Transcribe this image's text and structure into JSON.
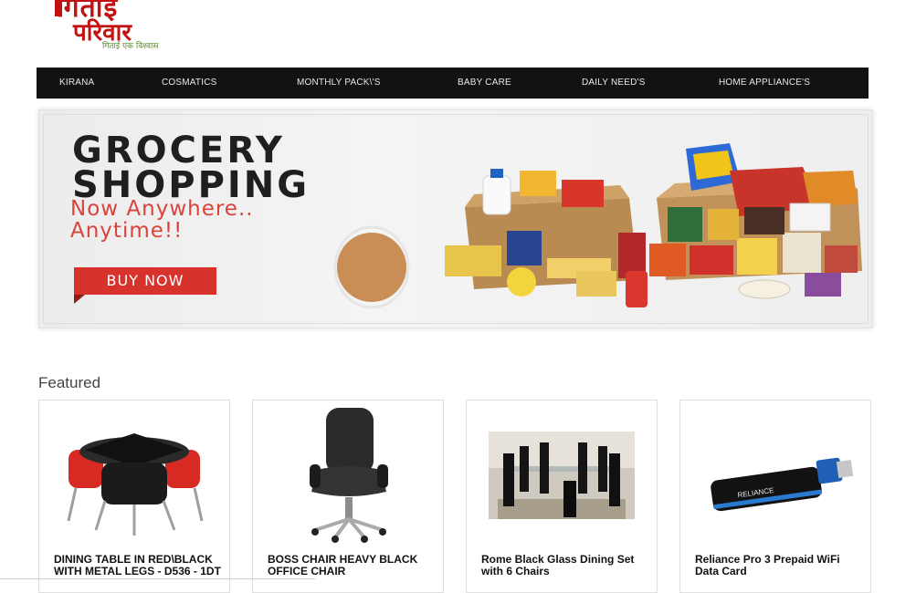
{
  "logo": {
    "line1": "गिताई",
    "line2": "परिवार",
    "tagline": "गिताई एक विश्वास"
  },
  "nav": [
    {
      "label": "KIRANA"
    },
    {
      "label": "COSMATICS"
    },
    {
      "label": "MONTHLY PACK\\'S"
    },
    {
      "label": "BABY CARE"
    },
    {
      "label": "DAILY NEED'S"
    },
    {
      "label": "HOME APPLIANCE'S"
    }
  ],
  "banner": {
    "line1": "GROCERY",
    "line2": "SHOPPING",
    "sub1": "Now Anywhere..",
    "sub2": "Anytime!!",
    "button": "BUY NOW"
  },
  "featured": {
    "heading": "Featured",
    "products": [
      {
        "title": "DINING TABLE IN RED\\BLACK WITH METAL LEGS - D536 - 1DT"
      },
      {
        "title": "BOSS CHAIR HEAVY BLACK OFFICE CHAIR"
      },
      {
        "title": "Rome Black Glass Dining Set with 6 Chairs"
      },
      {
        "title": "Reliance Pro 3 Prepaid WiFi Data Card"
      }
    ]
  },
  "colors": {
    "nav_bg": "#121212",
    "brand_red": "#c21212",
    "banner_accent": "#d7322c"
  }
}
